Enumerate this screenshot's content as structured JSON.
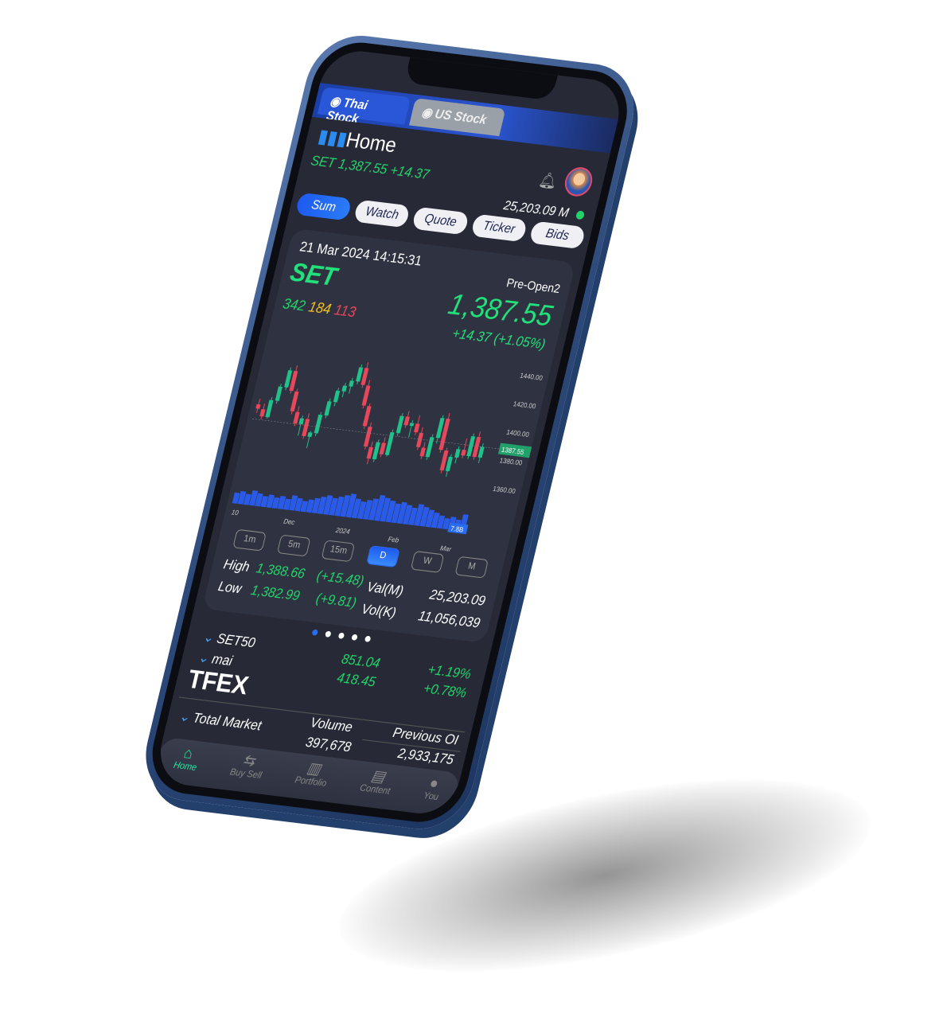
{
  "tabs": [
    {
      "label": "Thai Stock",
      "active": true
    },
    {
      "label": "US Stock",
      "active": false
    }
  ],
  "header": {
    "title": "Home",
    "set_line": "SET 1,387.55 +14.37",
    "value_m": "25,203.09 M",
    "status": "online"
  },
  "pills": [
    {
      "label": "Sum",
      "active": true
    },
    {
      "label": "Watch"
    },
    {
      "label": "Quote"
    },
    {
      "label": "Ticker"
    },
    {
      "label": "Bids"
    }
  ],
  "card": {
    "datetime": "21 Mar 2024 14:15:31",
    "index": "SET",
    "advance": "342",
    "unchanged": "184",
    "decline": "113",
    "session": "Pre-Open2",
    "price": "1,387.55",
    "change": "+14.37 (+1.05%)",
    "high_label": "High",
    "high": "1,388.66",
    "high_chg": "(+15.48)",
    "low_label": "Low",
    "low": "1,382.99",
    "low_chg": "(+9.81)",
    "val_label": "Val(M)",
    "val": "25,203.09",
    "vol_label": "Vol(K)",
    "vol": "11,056,039",
    "timeframes": [
      {
        "label": "1m"
      },
      {
        "label": "5m"
      },
      {
        "label": "15m"
      },
      {
        "label": "D",
        "active": true
      },
      {
        "label": "W"
      },
      {
        "label": "M"
      }
    ]
  },
  "chart_data": {
    "type": "candlestick",
    "ylim": [
      1355,
      1445
    ],
    "yticks": [
      "1440.00",
      "1420.00",
      "1400.00",
      "1380.00",
      "1360.00"
    ],
    "last_price_label": "1387.55",
    "volume_label": "7.8B",
    "xticks": [
      "10",
      "Dec",
      "2024",
      "Feb",
      "Mar"
    ],
    "colors": {
      "up": "#22c08a",
      "down": "#e5485a",
      "volume": "#2a5ae8"
    },
    "candles": [
      [
        1398,
        1402,
        1392,
        1395
      ],
      [
        1395,
        1399,
        1388,
        1390
      ],
      [
        1390,
        1404,
        1389,
        1402
      ],
      [
        1402,
        1414,
        1400,
        1412
      ],
      [
        1412,
        1426,
        1410,
        1424
      ],
      [
        1424,
        1428,
        1408,
        1410
      ],
      [
        1410,
        1412,
        1394,
        1396
      ],
      [
        1396,
        1400,
        1386,
        1388
      ],
      [
        1388,
        1394,
        1380,
        1392
      ],
      [
        1392,
        1396,
        1378,
        1380
      ],
      [
        1380,
        1384,
        1372,
        1383
      ],
      [
        1383,
        1398,
        1381,
        1396
      ],
      [
        1396,
        1408,
        1394,
        1406
      ],
      [
        1406,
        1416,
        1403,
        1414
      ],
      [
        1414,
        1420,
        1410,
        1418
      ],
      [
        1418,
        1424,
        1413,
        1422
      ],
      [
        1422,
        1434,
        1420,
        1432
      ],
      [
        1432,
        1436,
        1418,
        1420
      ],
      [
        1420,
        1424,
        1404,
        1406
      ],
      [
        1406,
        1408,
        1390,
        1392
      ],
      [
        1392,
        1395,
        1376,
        1378
      ],
      [
        1378,
        1382,
        1366,
        1370
      ],
      [
        1370,
        1384,
        1368,
        1382
      ],
      [
        1382,
        1386,
        1372,
        1374
      ],
      [
        1374,
        1392,
        1373,
        1390
      ],
      [
        1390,
        1404,
        1388,
        1402
      ],
      [
        1402,
        1406,
        1394,
        1396
      ],
      [
        1396,
        1400,
        1388,
        1398
      ],
      [
        1398,
        1404,
        1390,
        1392
      ],
      [
        1392,
        1396,
        1380,
        1382
      ],
      [
        1382,
        1386,
        1374,
        1376
      ],
      [
        1376,
        1392,
        1374,
        1390
      ],
      [
        1390,
        1406,
        1386,
        1404
      ],
      [
        1404,
        1408,
        1380,
        1382
      ],
      [
        1382,
        1384,
        1366,
        1368
      ],
      [
        1368,
        1380,
        1364,
        1378
      ],
      [
        1378,
        1386,
        1374,
        1384
      ],
      [
        1384,
        1392,
        1378,
        1380
      ],
      [
        1380,
        1396,
        1378,
        1394
      ],
      [
        1394,
        1398,
        1378,
        1380
      ],
      [
        1380,
        1390,
        1376,
        1387.55
      ]
    ],
    "volume": [
      5,
      6,
      5,
      7,
      6,
      5,
      6,
      5,
      6,
      5,
      7,
      6,
      5,
      6,
      7,
      8,
      9,
      8,
      9,
      10,
      11,
      9,
      8,
      9,
      10,
      12,
      11,
      10,
      9,
      10,
      9,
      8,
      10,
      9,
      8,
      7,
      6,
      5,
      6,
      5,
      7.8
    ]
  },
  "indices": [
    {
      "name": "SET50",
      "value": "851.04",
      "change": "+1.19%"
    },
    {
      "name": "mai",
      "value": "418.45",
      "change": "+0.78%"
    }
  ],
  "tfex": {
    "title": "TFEX",
    "row_label": "Total Market",
    "volume_label": "Volume",
    "oi_label": "Previous OI",
    "volume": "397,678",
    "oi": "2,933,175"
  },
  "nav": [
    {
      "label": "Home",
      "icon": "home-icon",
      "active": true
    },
    {
      "label": "Buy Sell",
      "icon": "swap-icon"
    },
    {
      "label": "Portfolio",
      "icon": "portfolio-icon"
    },
    {
      "label": "Content",
      "icon": "document-icon"
    },
    {
      "label": "You",
      "icon": "user-icon"
    }
  ]
}
